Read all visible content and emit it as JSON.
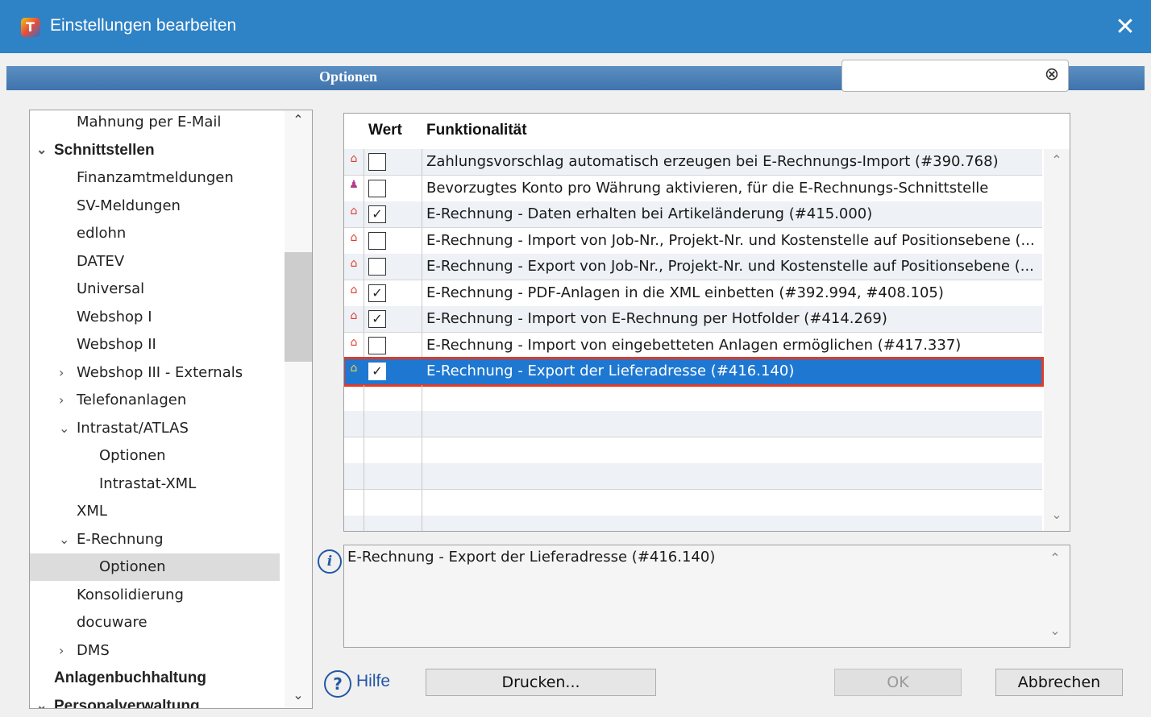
{
  "window": {
    "title": "Einstellungen bearbeiten",
    "close_icon": "close-icon"
  },
  "header": {
    "label": "Optionen"
  },
  "search": {
    "value": "",
    "clear_icon": "clear-circle-icon"
  },
  "tree": {
    "items": [
      {
        "label": "Mahnung per E-Mail",
        "level": 2,
        "bold": false,
        "toggle": "",
        "selected": false
      },
      {
        "label": "Schnittstellen",
        "level": 1,
        "bold": true,
        "toggle": "expanded",
        "selected": false
      },
      {
        "label": "Finanzamtmeldungen",
        "level": 2,
        "bold": false,
        "toggle": "",
        "selected": false
      },
      {
        "label": "SV-Meldungen",
        "level": 2,
        "bold": false,
        "toggle": "",
        "selected": false
      },
      {
        "label": "edlohn",
        "level": 2,
        "bold": false,
        "toggle": "",
        "selected": false
      },
      {
        "label": "DATEV",
        "level": 2,
        "bold": false,
        "toggle": "",
        "selected": false
      },
      {
        "label": "Universal",
        "level": 2,
        "bold": false,
        "toggle": "",
        "selected": false
      },
      {
        "label": "Webshop I",
        "level": 2,
        "bold": false,
        "toggle": "",
        "selected": false
      },
      {
        "label": "Webshop II",
        "level": 2,
        "bold": false,
        "toggle": "",
        "selected": false
      },
      {
        "label": "Webshop III - Externals",
        "level": 2,
        "bold": false,
        "toggle": "collapsed",
        "selected": false
      },
      {
        "label": "Telefonanlagen",
        "level": 2,
        "bold": false,
        "toggle": "collapsed",
        "selected": false
      },
      {
        "label": "Intrastat/ATLAS",
        "level": 2,
        "bold": false,
        "toggle": "expanded",
        "selected": false
      },
      {
        "label": "Optionen",
        "level": 3,
        "bold": false,
        "toggle": "",
        "selected": false
      },
      {
        "label": "Intrastat-XML",
        "level": 3,
        "bold": false,
        "toggle": "",
        "selected": false
      },
      {
        "label": "XML",
        "level": 2,
        "bold": false,
        "toggle": "",
        "selected": false
      },
      {
        "label": "E-Rechnung",
        "level": 2,
        "bold": false,
        "toggle": "expanded",
        "selected": false
      },
      {
        "label": "Optionen",
        "level": 3,
        "bold": false,
        "toggle": "",
        "selected": true
      },
      {
        "label": "Konsolidierung",
        "level": 2,
        "bold": false,
        "toggle": "",
        "selected": false
      },
      {
        "label": "docuware",
        "level": 2,
        "bold": false,
        "toggle": "",
        "selected": false
      },
      {
        "label": "DMS",
        "level": 2,
        "bold": false,
        "toggle": "collapsed",
        "selected": false
      },
      {
        "label": "Anlagenbuchhaltung",
        "level": 1,
        "bold": true,
        "toggle": "",
        "selected": false
      },
      {
        "label": "Personalverwaltung",
        "level": 1,
        "bold": true,
        "toggle": "expanded",
        "selected": false
      }
    ]
  },
  "grid": {
    "columns": {
      "value": "Wert",
      "function": "Funktionalität"
    },
    "rows": [
      {
        "icon": "house-arrow-icon",
        "checked": false,
        "text": "Zahlungsvorschlag automatisch erzeugen bei E-Rechnungs-Import (#390.768)"
      },
      {
        "icon": "people-icon",
        "checked": false,
        "text": "Bevorzugtes Konto pro Währung aktivieren, für die E-Rechnungs-Schnittstelle"
      },
      {
        "icon": "house-arrow-icon",
        "checked": true,
        "text": "E-Rechnung - Daten erhalten bei Artikeländerung (#415.000)"
      },
      {
        "icon": "house-arrow-icon",
        "checked": false,
        "text": "E-Rechnung - Import von Job-Nr., Projekt-Nr. und Kostenstelle auf Positionsebene (..."
      },
      {
        "icon": "house-arrow-icon",
        "checked": false,
        "text": "E-Rechnung - Export von Job-Nr., Projekt-Nr. und Kostenstelle auf Positionsebene (..."
      },
      {
        "icon": "house-arrow-icon",
        "checked": true,
        "text": "E-Rechnung - PDF-Anlagen in die XML einbetten (#392.994, #408.105)"
      },
      {
        "icon": "house-arrow-icon",
        "checked": true,
        "text": "E-Rechnung - Import von E-Rechnung per Hotfolder (#414.269)"
      },
      {
        "icon": "house-arrow-icon",
        "checked": false,
        "text": "E-Rechnung - Import von eingebetteten Anlagen ermöglichen (#417.337)"
      },
      {
        "icon": "house-arrow-icon",
        "checked": true,
        "text": "E-Rechnung - Export der Lieferadresse (#416.140)",
        "selected": true
      }
    ]
  },
  "description": {
    "text": "E-Rechnung - Export der Lieferadresse (#416.140)",
    "info_icon": "info-icon"
  },
  "footer": {
    "help_label": "Hilfe",
    "help_icon": "help-icon",
    "print_label": "Drucken...",
    "ok_label": "OK",
    "cancel_label": "Abbrechen"
  },
  "colors": {
    "titlebar": "#2e82c6",
    "selection": "#1e78d2",
    "selection_outline": "#e23a26"
  }
}
